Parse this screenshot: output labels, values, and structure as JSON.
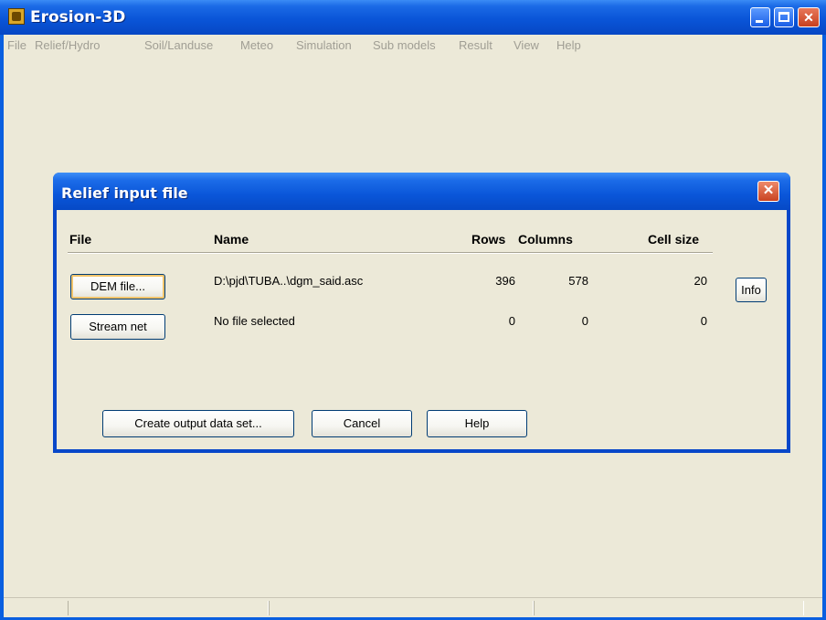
{
  "app": {
    "title": "Erosion-3D",
    "menu": [
      "File",
      "Relief/Hydro",
      "Soil/Landuse",
      "Meteo",
      "Simulation",
      "Sub models",
      "Result",
      "View",
      "Help"
    ]
  },
  "dialog": {
    "title": "Relief input file",
    "headers": {
      "file": "File",
      "name": "Name",
      "rows": "Rows",
      "columns": "Columns",
      "cell_size": "Cell size"
    },
    "rows": [
      {
        "button": "DEM file...",
        "name": "D:\\pjd\\TUBA..\\dgm_said.asc",
        "rows": "396",
        "columns": "578",
        "cell_size": "20"
      },
      {
        "button": "Stream net",
        "name": "No file selected",
        "rows": "0",
        "columns": "0",
        "cell_size": "0"
      }
    ],
    "info_button": "Info",
    "buttons": {
      "create_output": "Create output data set...",
      "cancel": "Cancel",
      "help": "Help"
    },
    "close_glyph": "✕"
  },
  "colors": {
    "titlebar": "#0a55d8",
    "dialog_bg": "#ece9d8",
    "menu_text_disabled": "#a09e94",
    "close_button": "#c94322"
  }
}
